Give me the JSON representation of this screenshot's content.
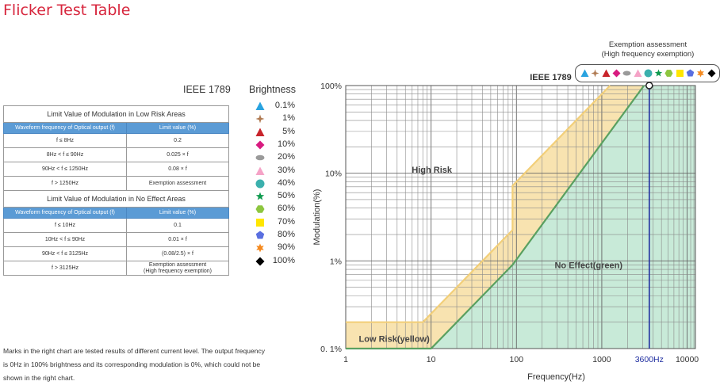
{
  "title": "Flicker Test Table",
  "standard_label": "IEEE 1789",
  "brightness": {
    "title": "Brightness",
    "items": [
      {
        "label": "0.1%",
        "shape": "triangle-up",
        "color": "#29a3e0"
      },
      {
        "label": "1%",
        "shape": "star4",
        "color": "#b07b53"
      },
      {
        "label": "5%",
        "shape": "triangle-up",
        "color": "#c8242b"
      },
      {
        "label": "10%",
        "shape": "diamond",
        "color": "#d81b80"
      },
      {
        "label": "20%",
        "shape": "ellipse",
        "color": "#9a9a9a"
      },
      {
        "label": "30%",
        "shape": "triangle-up",
        "color": "#f5a3c7"
      },
      {
        "label": "40%",
        "shape": "circle",
        "color": "#3bb0ad"
      },
      {
        "label": "50%",
        "shape": "star5",
        "color": "#0e9a4e"
      },
      {
        "label": "60%",
        "shape": "hexagon",
        "color": "#8dc63f"
      },
      {
        "label": "70%",
        "shape": "square",
        "color": "#ffe600"
      },
      {
        "label": "80%",
        "shape": "pentagon",
        "color": "#5a6fe0"
      },
      {
        "label": "90%",
        "shape": "star6",
        "color": "#f58a1f"
      },
      {
        "label": "100%",
        "shape": "diamond",
        "color": "#000000"
      }
    ]
  },
  "low_risk_table": {
    "title": "Limit Value of Modulation in Low Risk Areas",
    "headers": [
      "Waveform frequency of Optical output (f)",
      "Limit value (%)"
    ],
    "rows": [
      [
        "f ≤ 8Hz",
        "0.2"
      ],
      [
        "8Hz < f ≤ 90Hz",
        "0.025 × f"
      ],
      [
        "90Hz < f ≤ 1250Hz",
        "0.08 × f"
      ],
      [
        "f > 1250Hz",
        "Exemption assessment"
      ]
    ]
  },
  "no_effect_table": {
    "title": "Limit Value of Modulation in No Effect Areas",
    "headers": [
      "Waveform frequency of Optical output (f)",
      "Limit value (%)"
    ],
    "rows": [
      [
        "f ≤ 10Hz",
        "0.1"
      ],
      [
        "10Hz < f ≤ 90Hz",
        "0.01 × f"
      ],
      [
        "90Hz < f ≤ 3125Hz",
        "(0.08/2.5) × f"
      ],
      [
        "f > 3125Hz",
        "Exemption assessment\n(High frequency exemption)"
      ]
    ]
  },
  "notes": "Marks in the right chart are tested results of different current level. The output frequency is 0Hz in 100% brightness and its corresponding modulation is 0%, which could not be shown in the right chart.",
  "exemption_label": "Exemption assessment\n(High frequency exemption)",
  "chart_data": {
    "type": "area",
    "title": "IEEE 1789",
    "xlabel": "Frequency(Hz)",
    "ylabel": "Modulation(%)",
    "x_scale": "log",
    "y_scale": "log",
    "xlim": [
      1,
      12500
    ],
    "ylim": [
      0.1,
      100
    ],
    "x_ticks": [
      "1",
      "10",
      "100",
      "1000",
      "3600Hz",
      "10000"
    ],
    "x_tick_values": [
      1,
      10,
      100,
      1000,
      3600,
      10000
    ],
    "y_ticks": [
      "0. 1%",
      "1%",
      "10%",
      "100%"
    ],
    "y_tick_values": [
      0.1,
      1,
      10,
      100
    ],
    "grid": true,
    "colors": {
      "low_risk": "#f8e3b0",
      "low_risk_line": "#f2cf7a",
      "no_effect": "#c8ead8",
      "no_effect_line": "#5aa060",
      "marker_line": "#1f2ea0"
    },
    "series": [
      {
        "name": "Low Risk(yellow)",
        "x": [
          1,
          8,
          90,
          90,
          1250
        ],
        "y": [
          0.2,
          0.2,
          2.25,
          7.2,
          100
        ]
      },
      {
        "name": "No Effect(green)",
        "x": [
          1,
          10,
          90,
          3125
        ],
        "y": [
          0.1,
          0.1,
          0.9,
          100
        ]
      }
    ],
    "annotations": [
      "High Risk",
      "No Effect(green)",
      "Low Risk(yellow)"
    ],
    "measurement_frequency": 3600,
    "measurement_label": "3600Hz",
    "measurement_point": {
      "x": 3600,
      "y": 100
    }
  }
}
